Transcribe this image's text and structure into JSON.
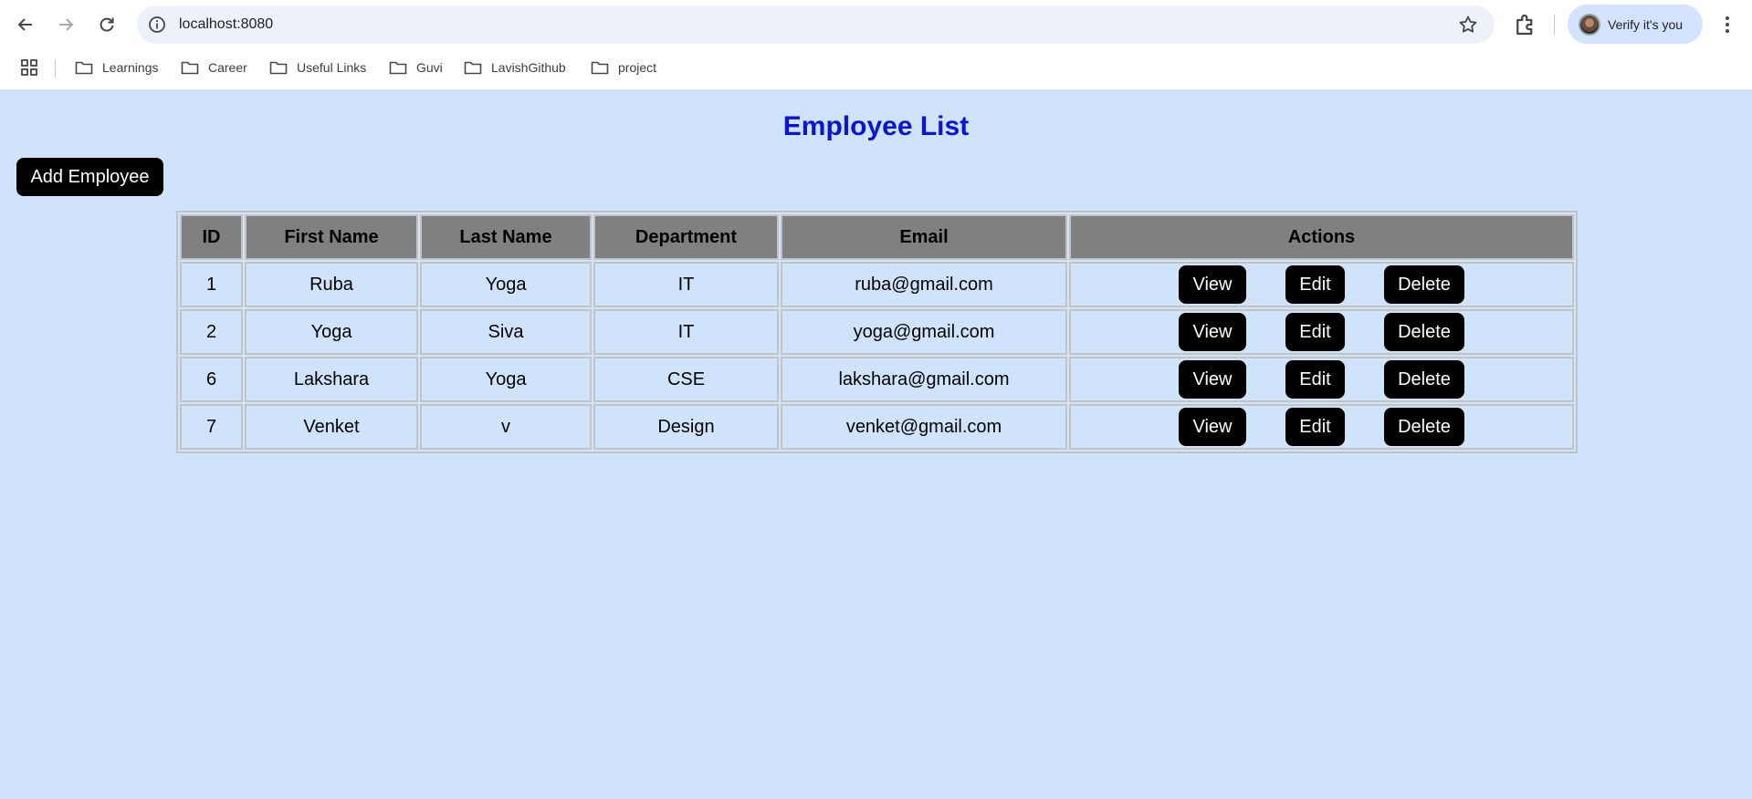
{
  "browser": {
    "url": "localhost:8080",
    "profile_label": "Verify it's you",
    "bookmarks": [
      "Learnings",
      "Career",
      "Useful Links",
      "Guvi",
      "LavishGithub",
      "project"
    ]
  },
  "page": {
    "title": "Employee List",
    "add_button": "Add Employee",
    "table": {
      "headers": [
        "ID",
        "First Name",
        "Last Name",
        "Department",
        "Email",
        "Actions"
      ],
      "rows": [
        {
          "id": "1",
          "first": "Ruba",
          "last": "Yoga",
          "dept": "IT",
          "email": "ruba@gmail.com"
        },
        {
          "id": "2",
          "first": "Yoga",
          "last": "Siva",
          "dept": "IT",
          "email": "yoga@gmail.com"
        },
        {
          "id": "6",
          "first": "Lakshara",
          "last": "Yoga",
          "dept": "CSE",
          "email": "lakshara@gmail.com"
        },
        {
          "id": "7",
          "first": "Venket",
          "last": "v",
          "dept": "Design",
          "email": "venket@gmail.com"
        }
      ],
      "action_labels": {
        "view": "View",
        "edit": "Edit",
        "delete": "Delete"
      }
    }
  },
  "colors": {
    "page_bg": "#cfe4fb",
    "title": "#0a12e0",
    "header_bg": "#808080",
    "button_bg": "#000000"
  }
}
